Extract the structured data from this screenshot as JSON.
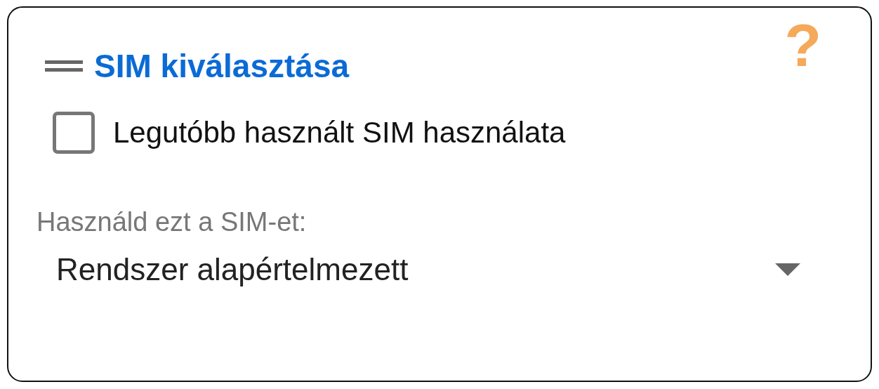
{
  "card": {
    "title": "SIM kiválasztása",
    "help": "?"
  },
  "checkbox": {
    "label": "Legutóbb használt SIM használata",
    "checked": false
  },
  "sim_select": {
    "label": "Használd ezt a SIM-et:",
    "value": "Rendszer alapértelmezett"
  }
}
